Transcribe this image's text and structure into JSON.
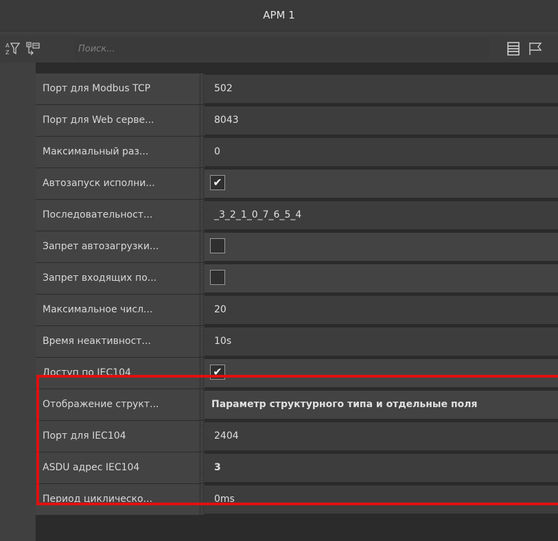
{
  "window": {
    "title": "АРМ 1"
  },
  "toolbar": {
    "search_placeholder": "Поиск...",
    "sort_icon": "sort-az-filter-icon",
    "tree_icon": "tree-expand-icon",
    "list_icon": "list-view-icon",
    "flag_icon": "flag-icon"
  },
  "properties": [
    {
      "label": "Порт для Modbus TCP",
      "value": "502"
    },
    {
      "label": "Порт для Web серве...",
      "value": "8043"
    },
    {
      "label": "Максимальный раз...",
      "value": "0"
    },
    {
      "label": "Автозапуск исполни...",
      "checked": true
    },
    {
      "label": "Последовательност...",
      "value": "_3_2_1_0_7_6_5_4"
    },
    {
      "label": "Запрет автозагрузки...",
      "checked": false
    },
    {
      "label": "Запрет входящих по...",
      "checked": false
    },
    {
      "label": "Максимальное числ...",
      "value": "20"
    },
    {
      "label": "Время неактивност...",
      "value": "10s"
    },
    {
      "label": "Доступ по IEC104",
      "checked": true
    },
    {
      "label": "Отображение структ...",
      "value": "Параметр структурного типа и отдельные поля"
    },
    {
      "label": "Порт для IEC104",
      "value": "2404"
    },
    {
      "label": "ASDU адрес IEC104",
      "value": "3"
    },
    {
      "label": "Период циклическо...",
      "value": "0ms"
    }
  ],
  "colors": {
    "highlight": "#e01010",
    "background": "#404040"
  }
}
